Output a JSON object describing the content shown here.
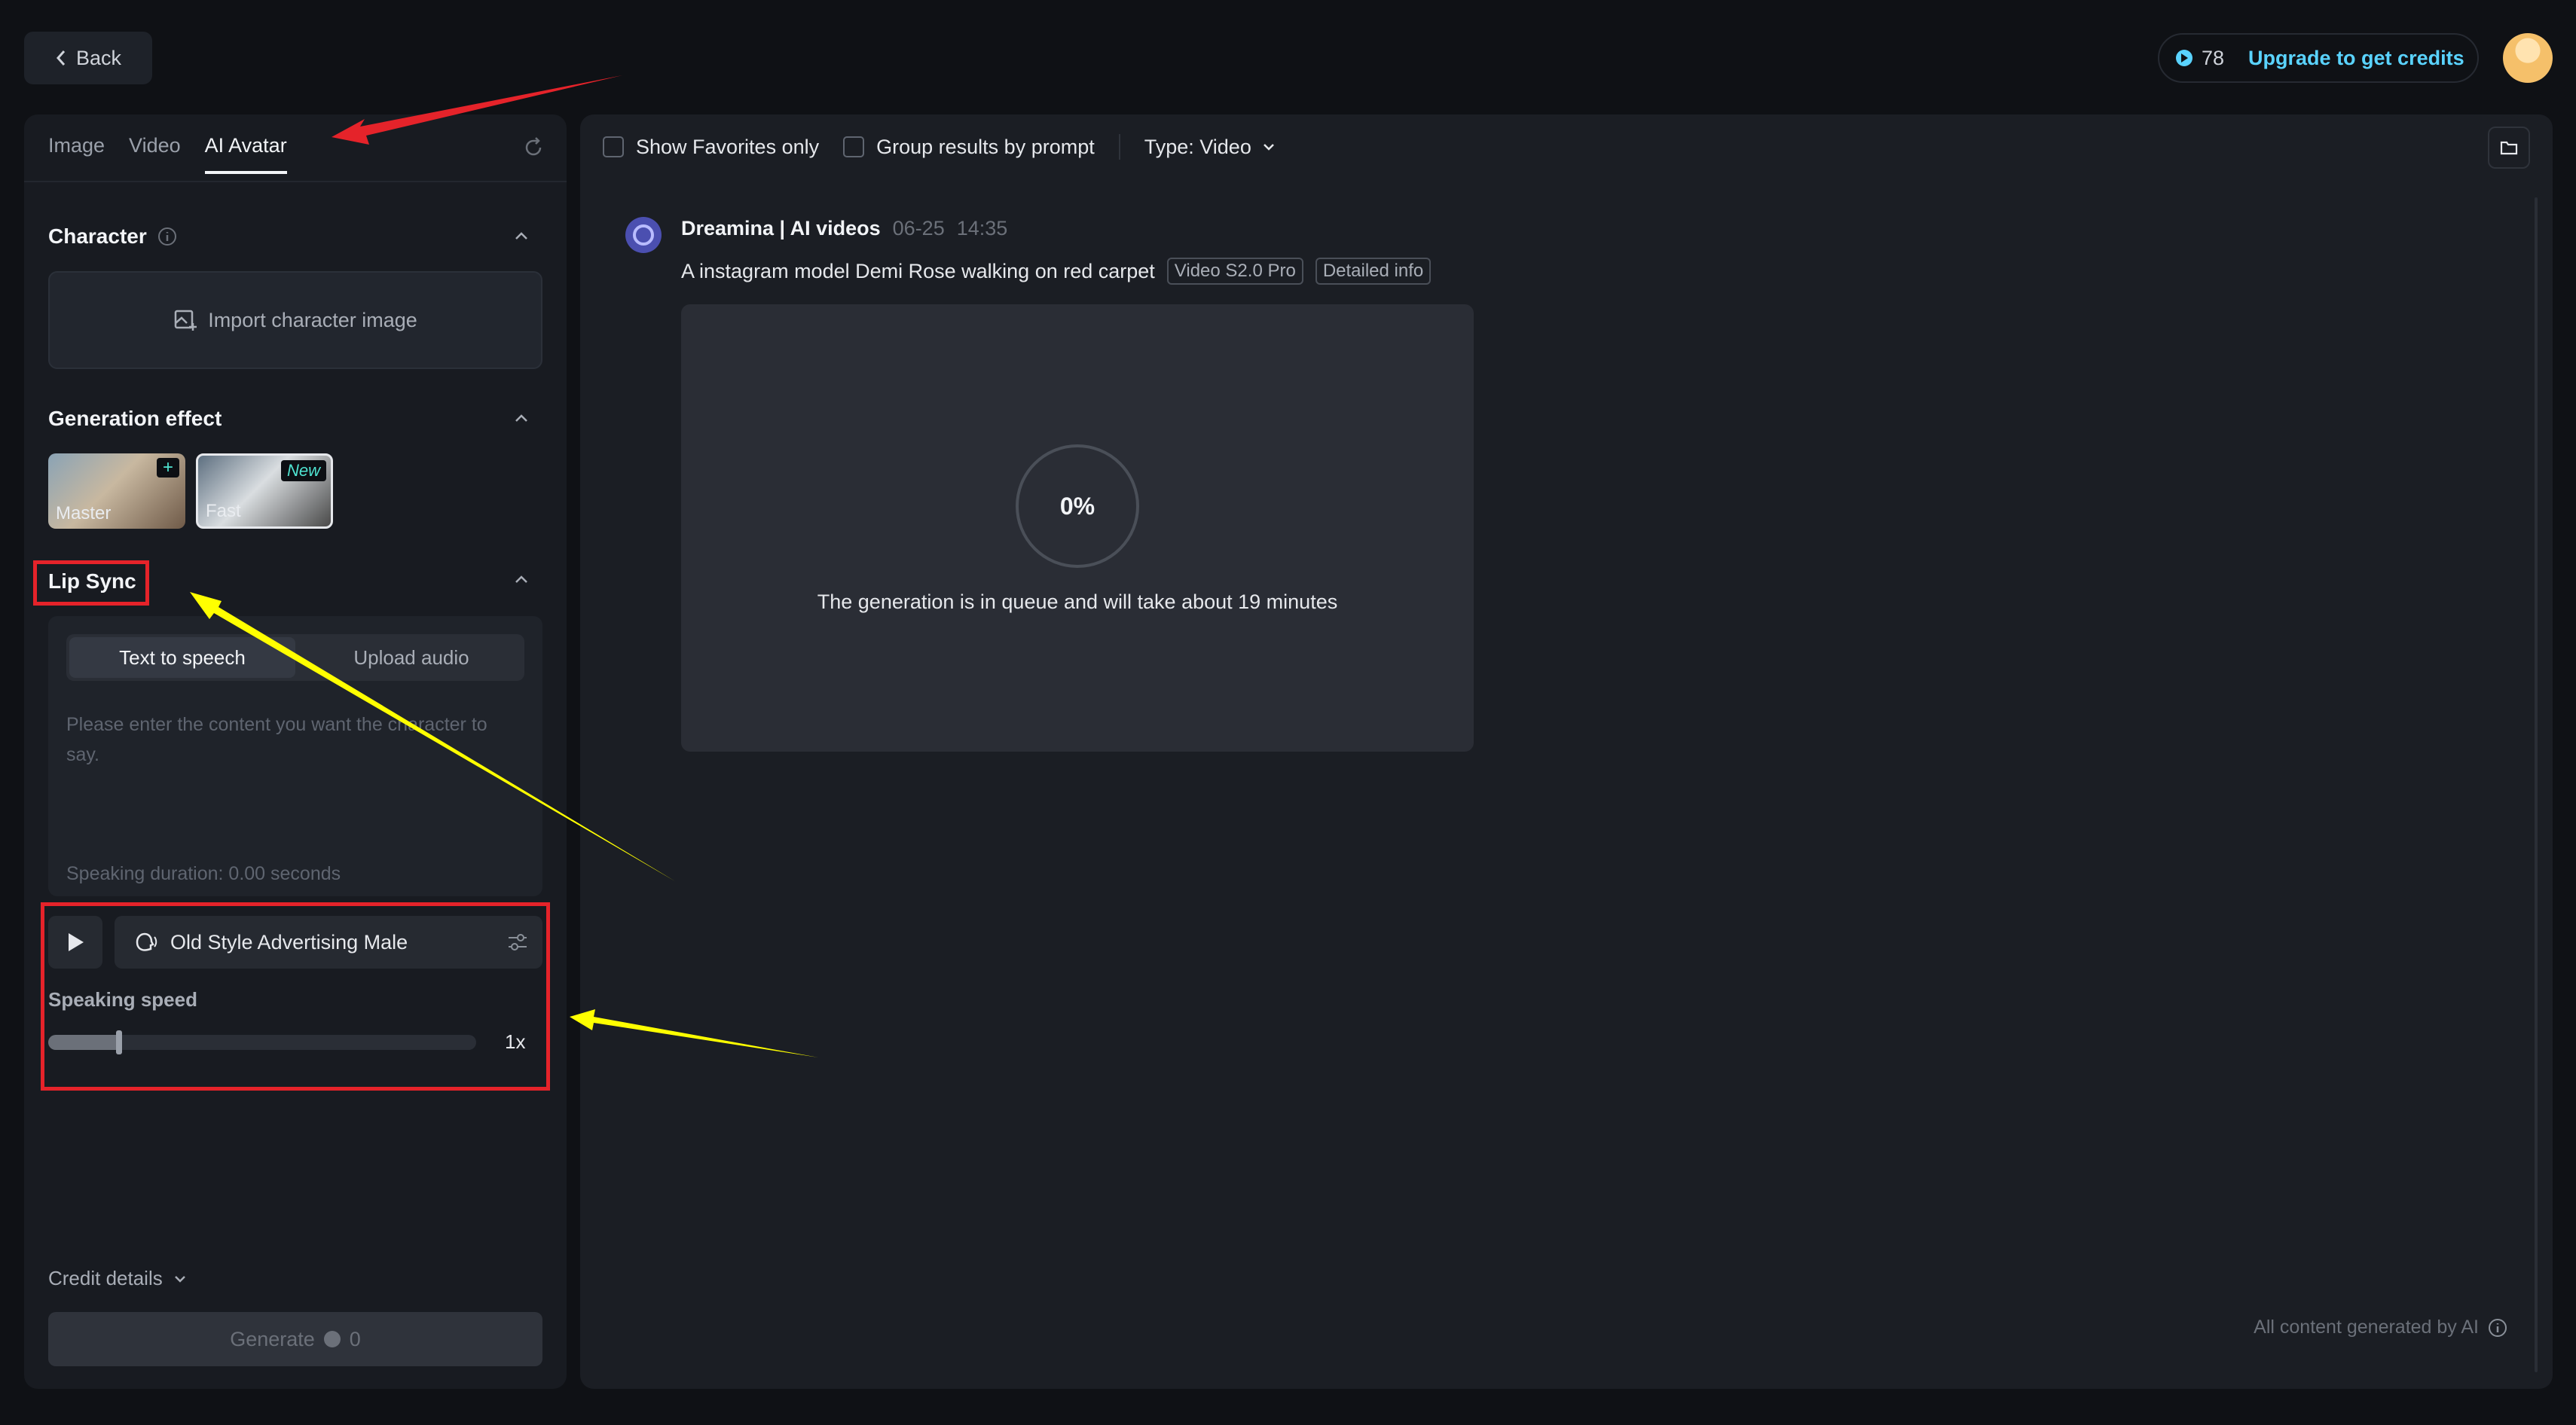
{
  "header": {
    "back_label": "Back",
    "credits": "78",
    "upgrade_label": "Upgrade to get credits"
  },
  "left_panel": {
    "tabs": [
      {
        "label": "Image"
      },
      {
        "label": "Video"
      },
      {
        "label": "AI Avatar",
        "active": true
      }
    ],
    "character": {
      "title": "Character",
      "import_label": "Import character image"
    },
    "generation_effect": {
      "title": "Generation effect",
      "options": [
        {
          "label": "Master",
          "badge": "+"
        },
        {
          "label": "Fast",
          "badge": "New",
          "selected": true
        }
      ]
    },
    "lip_sync": {
      "title": "Lip Sync",
      "modes": [
        "Text to speech",
        "Upload audio"
      ],
      "active_mode": "Text to speech",
      "placeholder": "Please enter the content you want the character to say.",
      "duration": "Speaking duration: 0.00 seconds",
      "voice": "Old Style Advertising Male",
      "speed_label": "Speaking speed",
      "speed_value": "1x",
      "speed_fraction": 0.165
    },
    "credit_details_label": "Credit details",
    "generate_label": "Generate",
    "generate_cost": "0"
  },
  "right_panel": {
    "filters": {
      "favorites_label": "Show Favorites only",
      "group_label": "Group results by prompt",
      "type_label": "Type: Video"
    },
    "result": {
      "author": "Dreamina | AI videos",
      "date": "06-25",
      "time": "14:35",
      "prompt": "A instagram model Demi Rose walking on red carpet",
      "tags": [
        "Video S2.0 Pro",
        "Detailed info"
      ],
      "progress": "0%",
      "queue_message": "The generation is in queue and will take about 19 minutes"
    },
    "footer_note": "All content generated by AI"
  },
  "colors": {
    "accent": "#5ad3ff",
    "annotation_red": "#e5232a",
    "annotation_yellow": "#ffff00",
    "badge_teal": "#4fe3d0"
  }
}
